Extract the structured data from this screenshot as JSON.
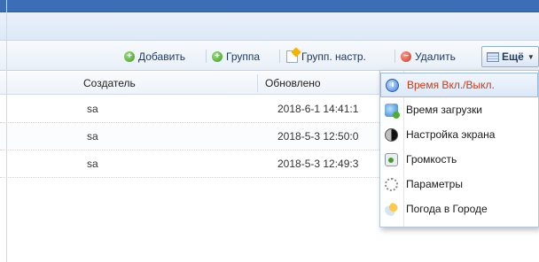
{
  "toolbar": {
    "add_label": "Добавить",
    "group_label": "Группа",
    "group_settings_label": "Групп. настр.",
    "delete_label": "Удалить",
    "more_label": "Ещё"
  },
  "grid": {
    "columns": [
      "Создатель",
      "Обновлено"
    ],
    "rows": [
      {
        "creator": "sa",
        "updated": "2018-6-1 14:41:1"
      },
      {
        "creator": "sa",
        "updated": "2018-5-3 12:50:0"
      },
      {
        "creator": "sa",
        "updated": "2018-5-3 12:49:3"
      }
    ]
  },
  "menu": {
    "items": [
      {
        "label": "Время Вкл./Выкл.",
        "icon": "clock-icon",
        "active": true
      },
      {
        "label": "Время загрузки",
        "icon": "download-icon",
        "active": false
      },
      {
        "label": "Настройка экрана",
        "icon": "screen-icon",
        "active": false
      },
      {
        "label": "Громкость",
        "icon": "volume-icon",
        "active": false
      },
      {
        "label": "Параметры",
        "icon": "gear-icon",
        "active": false
      },
      {
        "label": "Погода в Городе",
        "icon": "weather-icon",
        "active": false
      }
    ]
  },
  "colors": {
    "header_blue": "#3a6fb5",
    "active_text": "#d2380f",
    "toolbar_text": "#1f3a60"
  }
}
